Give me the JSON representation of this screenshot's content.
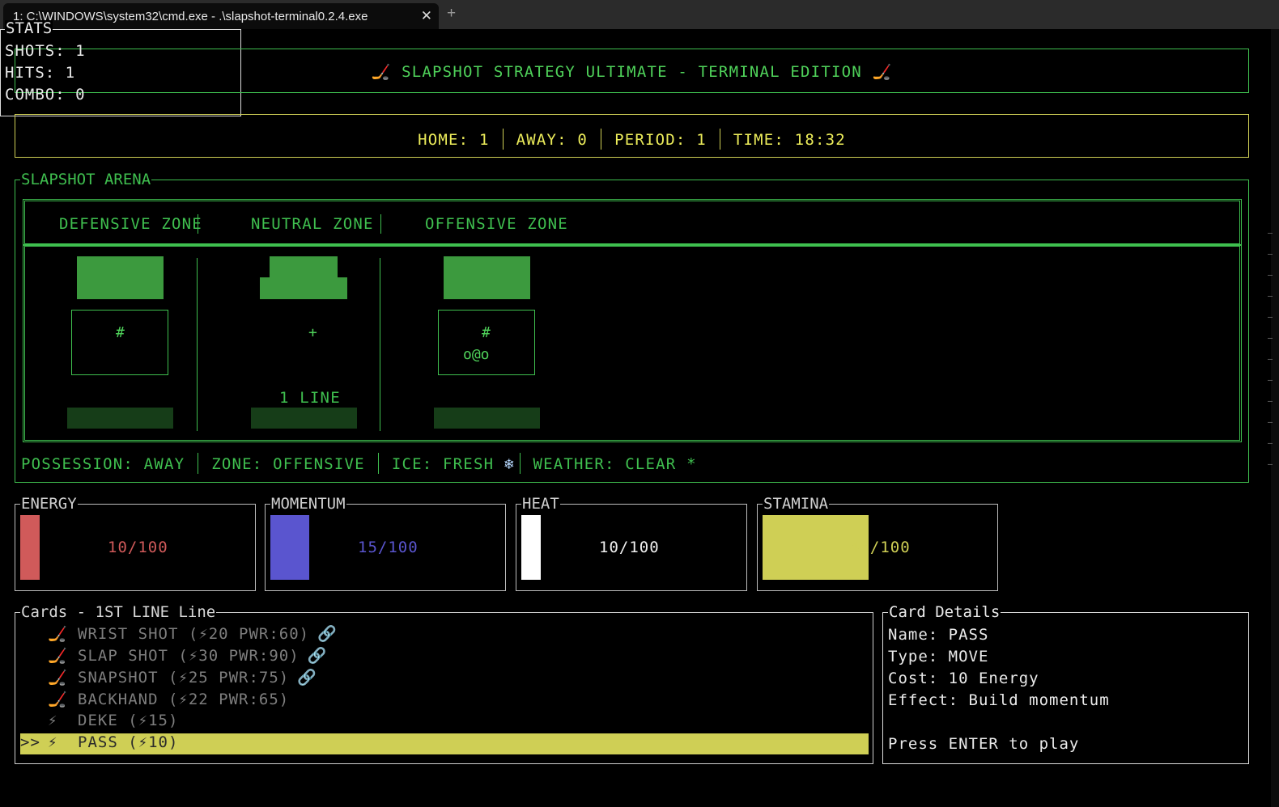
{
  "window": {
    "tab_title": "1: C:\\WINDOWS\\system32\\cmd.exe - .\\slapshot-terminal0.2.4.exe",
    "close_glyph": "✕",
    "new_tab_glyph": "+"
  },
  "header": {
    "title": "🏒 SLAPSHOT STRATEGY ULTIMATE - TERMINAL EDITION 🏒"
  },
  "scoreboard": {
    "home": "HOME: 1",
    "away": "AWAY: 0",
    "period": "PERIOD: 1",
    "time": "TIME: 18:32"
  },
  "arena": {
    "title": "SLAPSHOT ARENA",
    "zones": [
      "DEFENSIVE ZONE",
      "NEUTRAL ZONE",
      "OFFENSIVE ZONE"
    ],
    "defensive_marker": "#",
    "neutral_marker": "+",
    "offensive_marker": "#",
    "players": "o@o",
    "line_label": "1 LINE",
    "status": {
      "possession": "POSSESSION: AWAY",
      "zone": "ZONE: OFFENSIVE",
      "ice": "ICE: FRESH",
      "ice_icon": "❄",
      "weather": "WEATHER: CLEAR *"
    }
  },
  "meters": [
    {
      "label": "ENERGY",
      "value": 10,
      "max": 100,
      "text": "10/100",
      "color": "#d05a5a"
    },
    {
      "label": "MOMENTUM",
      "value": 15,
      "max": 100,
      "text": "15/100",
      "color": "#5a55cf"
    },
    {
      "label": "HEAT",
      "value": 10,
      "max": 100,
      "text": "10/100",
      "color": "#ffffff"
    },
    {
      "label": "STAMINA",
      "value": 46,
      "max": 100,
      "text": "46/100",
      "color": "#cfcf55"
    }
  ],
  "stats": {
    "title": "STATS",
    "shots": "SHOTS: 1",
    "hits": "HITS: 1",
    "combo": "COMBO: 0"
  },
  "cards": {
    "title": "Cards - 1ST LINE Line",
    "items": [
      {
        "cursor": "",
        "icon": "🏒",
        "text": "WRIST SHOT (⚡20 PWR:60)",
        "link": "🔗"
      },
      {
        "cursor": "",
        "icon": "🏒",
        "text": "SLAP SHOT (⚡30 PWR:90)",
        "link": "🔗"
      },
      {
        "cursor": "",
        "icon": "🏒",
        "text": "SNAPSHOT (⚡25 PWR:75)",
        "link": "🔗"
      },
      {
        "cursor": "",
        "icon": "🏒",
        "text": "BACKHAND (⚡22 PWR:65)",
        "link": ""
      },
      {
        "cursor": "",
        "icon": "⚡",
        "text": "DEKE (⚡15)",
        "link": ""
      },
      {
        "cursor": ">>",
        "icon": "⚡",
        "text": "PASS (⚡10)",
        "link": ""
      }
    ],
    "selected_index": 5
  },
  "card_details": {
    "title": "Card Details",
    "name": "Name: PASS",
    "type": "Type: MOVE",
    "cost": "Cost: 10 Energy",
    "effect": "Effect: Build momentum",
    "hint": "Press ENTER to play"
  },
  "colors": {
    "terminal_green": "#3fbf4f",
    "scoreboard_yellow": "#ecec5a",
    "selection": "#cfcf55"
  }
}
